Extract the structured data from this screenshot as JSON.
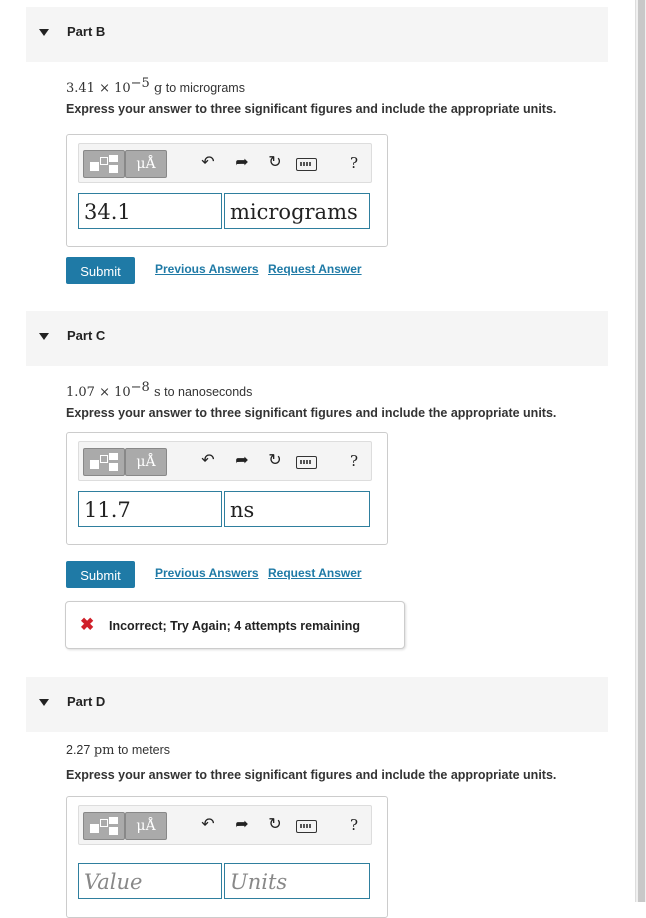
{
  "toolbar": {
    "units_label": "μÅ",
    "undo_icon": "undo-icon",
    "redo_icon": "redo-icon",
    "reset_icon": "reset-icon",
    "keyboard_icon": "keyboard-icon",
    "help_label": "?"
  },
  "parts": [
    {
      "title": "Part B",
      "question_math": "3.41 × 10",
      "question_exp": "−5",
      "question_unit": " g",
      "question_text": " to micrograms",
      "instruction": "Express your answer to three significant figures and include the appropriate units.",
      "value": "34.1",
      "units": "micrograms",
      "submit": "Submit",
      "previous_answers": "Previous Answers",
      "request_answer": "Request Answer"
    },
    {
      "title": "Part C",
      "question_math": "1.07 × 10",
      "question_exp": "−8",
      "question_unit": " s",
      "question_text": " to nanoseconds",
      "instruction": "Express your answer to three significant figures and include the appropriate units.",
      "value": "11.7",
      "units": "ns",
      "submit": "Submit",
      "previous_answers": "Previous Answers",
      "request_answer": "Request Answer",
      "feedback": "Incorrect; Try Again; 4 attempts remaining",
      "feedback_icon": "✖"
    },
    {
      "title": "Part D",
      "question_prefix": "2.27 ",
      "question_unit": "pm",
      "question_text": " to meters",
      "instruction": "Express your answer to three significant figures and include the appropriate units.",
      "value_placeholder": "Value",
      "units_placeholder": "Units"
    }
  ]
}
